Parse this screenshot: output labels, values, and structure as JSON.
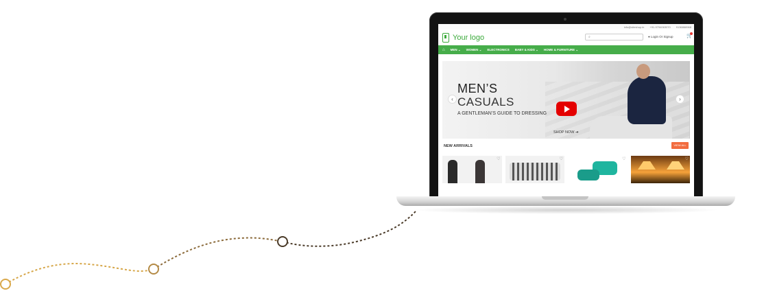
{
  "colors": {
    "brand_green": "#46ad4a",
    "accent_orange": "#f26c3f",
    "youtube_red": "#e40000",
    "path_gold": "#d9a84a",
    "path_brown": "#4a3a28"
  },
  "site": {
    "topbar": {
      "email": "info@siteshop.in",
      "phone": "+91-9794063070",
      "phone2": "9136868968"
    },
    "logo_text": "Your logo",
    "search_placeholder": "",
    "login_label": "Login Or Signup",
    "cart_icon": "cart-icon",
    "nav": {
      "home_icon": "home-icon",
      "items": [
        "MEN",
        "WOMEN",
        "ELECTRONICS",
        "BABY & KIDS",
        "HOME & FURNITURE"
      ]
    },
    "hero": {
      "title_line1": "MEN’S",
      "title_line2": "CASUALS",
      "subtitle": "A GENTLEMAN’S GUIDE TO DRESSING",
      "cta": "SHOP NOW ➔"
    },
    "arrivals": {
      "title": "NEW ARRIVALS",
      "view_all": "VIEW ALL"
    }
  }
}
